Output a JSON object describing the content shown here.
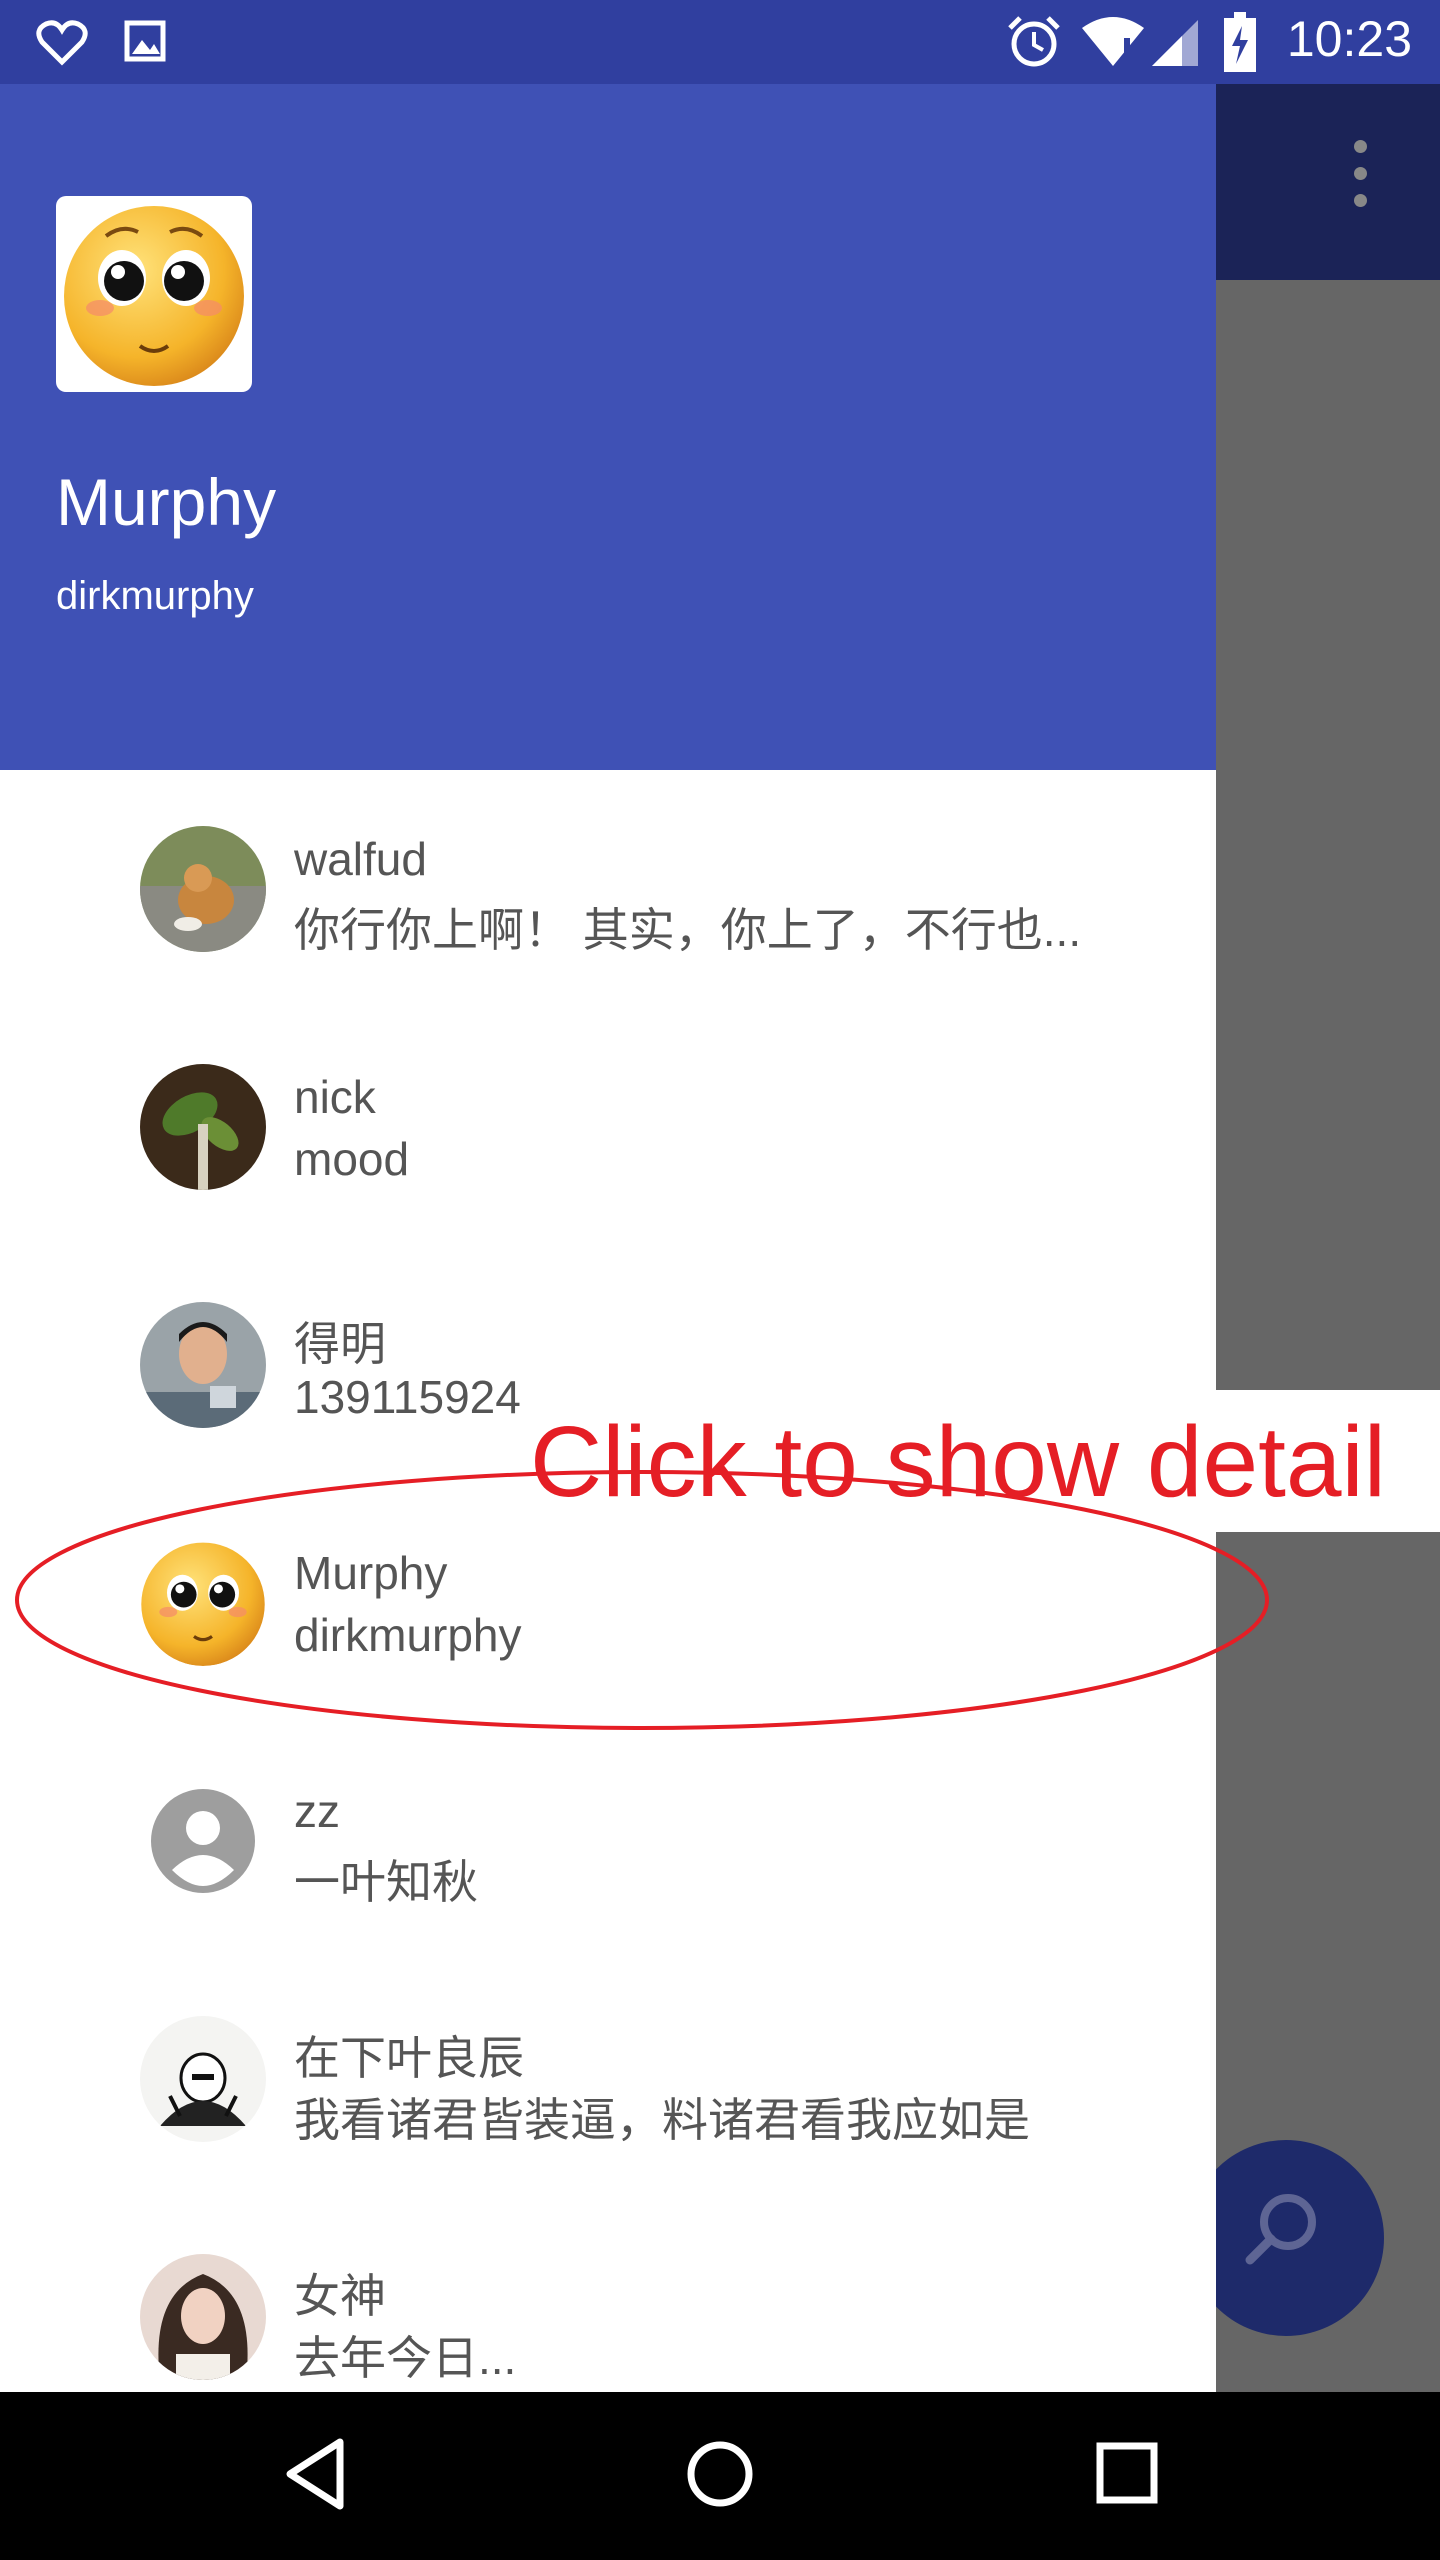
{
  "status_bar": {
    "time": "10:23"
  },
  "drawer": {
    "profile": {
      "name": "Murphy",
      "username": "dirkmurphy"
    }
  },
  "contacts": [
    {
      "name": "walfud",
      "status": "你行你上啊！ 其实，你上了，不行也..."
    },
    {
      "name": "nick",
      "status": "mood"
    },
    {
      "name": "得明",
      "status": "139115924"
    },
    {
      "name": "Murphy",
      "status": "dirkmurphy"
    },
    {
      "name": "zz",
      "status": "一叶知秋"
    },
    {
      "name": "在下叶良辰",
      "status": "我看诸君皆装逼，料诸君看我应如是"
    },
    {
      "name": "女神",
      "status": "去年今日..."
    }
  ],
  "annotation": {
    "text": "Click to show detail",
    "color": "#e51e25"
  },
  "colors": {
    "primary": "#3f51b5",
    "primary_dark": "#303f9f",
    "toolbar_dark": "#1b2357",
    "fab": "#1e2a6a"
  },
  "icons": [
    "heart-icon",
    "image-icon",
    "alarm-icon",
    "wifi-icon",
    "signal-icon",
    "battery-charging-icon",
    "overflow-menu-icon",
    "search-icon",
    "back-icon",
    "home-icon",
    "recents-icon",
    "default-person-icon"
  ]
}
